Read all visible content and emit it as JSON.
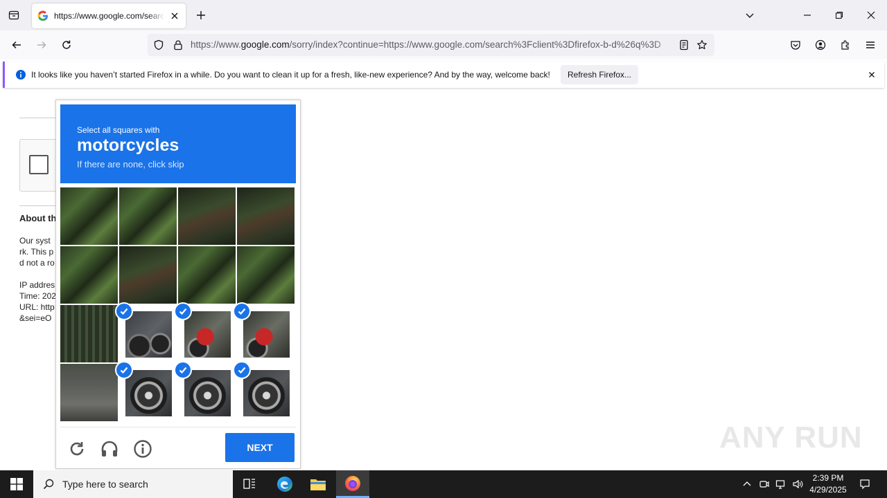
{
  "browser": {
    "tab_title": "https://www.google.com/search?client=firefox-b-d&q=",
    "url_prefix": "https://www.",
    "url_domain": "google.com",
    "url_rest": "/sorry/index?continue=https://www.google.com/search%3Fclient%3Dfirefox-b-d%26q%3D"
  },
  "notification": {
    "message": "It looks like you haven’t started Firefox in a while. Do you want to clean it up for a fresh, like-new experience? And by the way, welcome back!",
    "button": "Refresh Firefox..."
  },
  "page": {
    "about": "About this page",
    "text_lines": [
      "Our syst",
      "rk. This p",
      "d not a ro",
      "",
      "IP addres",
      "Time: 202",
      "URL: http",
      "&sei=eO"
    ]
  },
  "captcha": {
    "instruction": "Select all squares with",
    "target": "motorcycles",
    "hint": "If there are none, click skip",
    "next_label": "NEXT",
    "tiles": [
      {
        "selected": false,
        "scene": "foliage"
      },
      {
        "selected": false,
        "scene": "foliage"
      },
      {
        "selected": false,
        "scene": "tree"
      },
      {
        "selected": false,
        "scene": "tree"
      },
      {
        "selected": false,
        "scene": "foliage"
      },
      {
        "selected": false,
        "scene": "tree"
      },
      {
        "selected": false,
        "scene": "foliage"
      },
      {
        "selected": false,
        "scene": "foliage"
      },
      {
        "selected": false,
        "scene": "fence"
      },
      {
        "selected": true,
        "scene": "motorcycle"
      },
      {
        "selected": true,
        "scene": "motorcycle-red"
      },
      {
        "selected": true,
        "scene": "motorcycle-red"
      },
      {
        "selected": false,
        "scene": "road"
      },
      {
        "selected": true,
        "scene": "wheel"
      },
      {
        "selected": true,
        "scene": "wheel"
      },
      {
        "selected": true,
        "scene": "wheel"
      }
    ]
  },
  "watermark": "ANY RUN",
  "taskbar": {
    "search_placeholder": "Type here to search",
    "time": "2:39 PM",
    "date": "4/29/2025"
  },
  "colors": {
    "accent": "#1a73e8",
    "firefox_purple": "#9059ff"
  }
}
